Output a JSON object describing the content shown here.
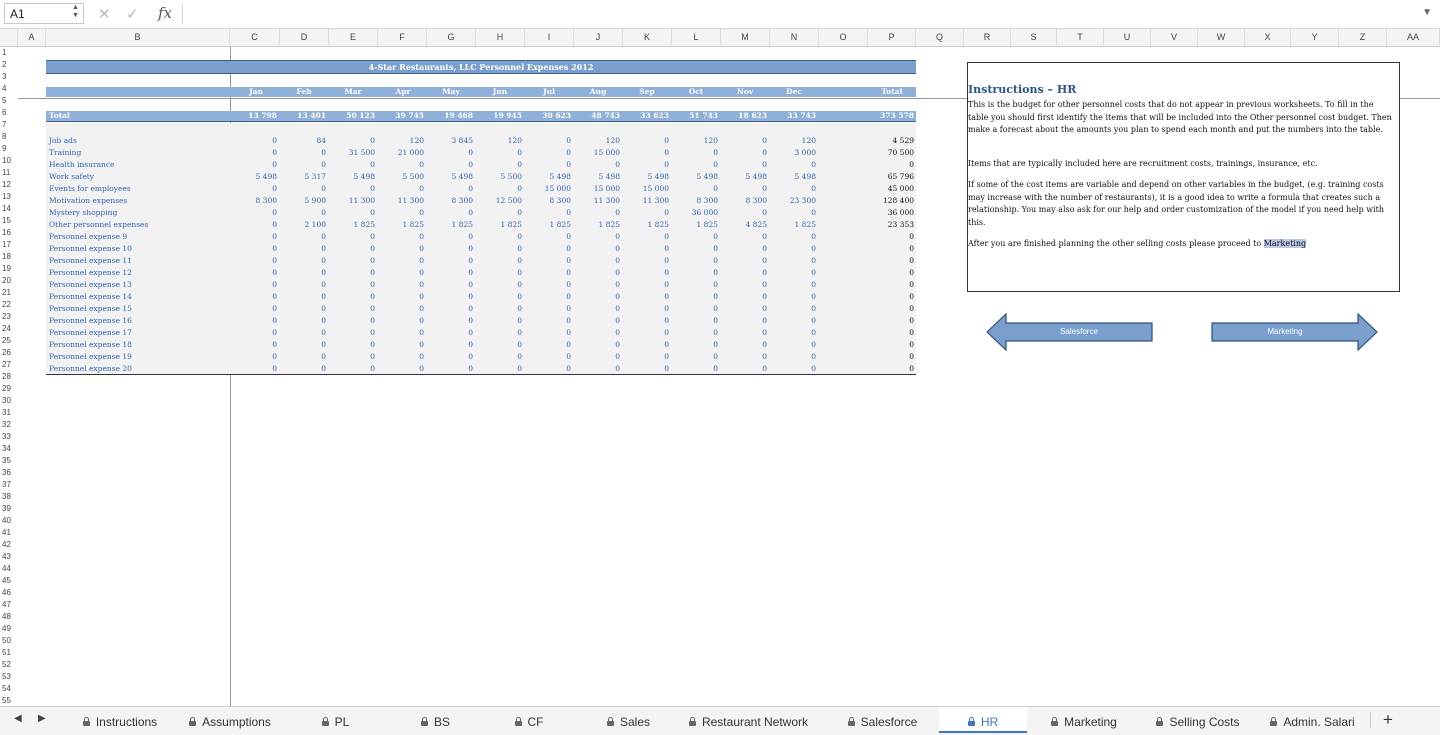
{
  "formula_bar": {
    "cell_ref": "A1",
    "fx_label": "fx",
    "formula": ""
  },
  "columns": [
    "A",
    "B",
    "C",
    "D",
    "E",
    "F",
    "G",
    "H",
    "I",
    "J",
    "K",
    "L",
    "M",
    "N",
    "O",
    "P",
    "Q",
    "R",
    "S",
    "T",
    "U",
    "V",
    "W",
    "X",
    "Y",
    "Z",
    "AA"
  ],
  "rows_start": 1,
  "rows_end": 55,
  "sheet": {
    "title": "4-Star Restaurants, LLC Personnel Expenses 2012",
    "months": [
      "Jan",
      "Feb",
      "Mar",
      "Apr",
      "May",
      "Jun",
      "Jul",
      "Aug",
      "Sep",
      "Oct",
      "Nov",
      "Dec"
    ],
    "total_header": "Total",
    "total_row": {
      "label": "Total",
      "values": [
        "13 798",
        "13 401",
        "50 123",
        "39 745",
        "19 468",
        "19 945",
        "30 623",
        "48 743",
        "33 623",
        "51 743",
        "18 623",
        "33 743"
      ],
      "total": "373 578"
    },
    "items": [
      {
        "label": "Job ads",
        "values": [
          "0",
          "84",
          "0",
          "120",
          "3 845",
          "120",
          "0",
          "120",
          "0",
          "120",
          "0",
          "120"
        ],
        "total": "4 529"
      },
      {
        "label": "Training",
        "values": [
          "0",
          "0",
          "31 500",
          "21 000",
          "0",
          "0",
          "0",
          "15 000",
          "0",
          "0",
          "0",
          "3 000"
        ],
        "total": "70 500"
      },
      {
        "label": "Health insurance",
        "values": [
          "0",
          "0",
          "0",
          "0",
          "0",
          "0",
          "0",
          "0",
          "0",
          "0",
          "0",
          "0"
        ],
        "total": "0"
      },
      {
        "label": "Work safety",
        "values": [
          "5 498",
          "5 317",
          "5 498",
          "5 500",
          "5 498",
          "5 500",
          "5 498",
          "5 498",
          "5 498",
          "5 498",
          "5 498",
          "5 498"
        ],
        "total": "65 796"
      },
      {
        "label": "Events for employees",
        "values": [
          "0",
          "0",
          "0",
          "0",
          "0",
          "0",
          "15 000",
          "15 000",
          "15 000",
          "0",
          "0",
          "0"
        ],
        "total": "45 000"
      },
      {
        "label": "Motivation expenses",
        "values": [
          "8 300",
          "5 900",
          "11 300",
          "11 300",
          "8 300",
          "12 500",
          "8 300",
          "11 300",
          "11 300",
          "8 300",
          "8 300",
          "23 300"
        ],
        "total": "128 400"
      },
      {
        "label": "Mystery shopping",
        "values": [
          "0",
          "0",
          "0",
          "0",
          "0",
          "0",
          "0",
          "0",
          "0",
          "36 000",
          "0",
          "0"
        ],
        "total": "36 000"
      },
      {
        "label": "Other personnel expenses",
        "values": [
          "0",
          "2 100",
          "1 825",
          "1 825",
          "1 825",
          "1 825",
          "1 825",
          "1 825",
          "1 825",
          "1 825",
          "4 825",
          "1 825"
        ],
        "total": "23 353"
      },
      {
        "label": "Personnel expense 9",
        "values": [
          "0",
          "0",
          "0",
          "0",
          "0",
          "0",
          "0",
          "0",
          "0",
          "0",
          "0",
          "0"
        ],
        "total": "0"
      },
      {
        "label": "Personnel expense 10",
        "values": [
          "0",
          "0",
          "0",
          "0",
          "0",
          "0",
          "0",
          "0",
          "0",
          "0",
          "0",
          "0"
        ],
        "total": "0"
      },
      {
        "label": "Personnel expense 11",
        "values": [
          "0",
          "0",
          "0",
          "0",
          "0",
          "0",
          "0",
          "0",
          "0",
          "0",
          "0",
          "0"
        ],
        "total": "0"
      },
      {
        "label": "Personnel expense 12",
        "values": [
          "0",
          "0",
          "0",
          "0",
          "0",
          "0",
          "0",
          "0",
          "0",
          "0",
          "0",
          "0"
        ],
        "total": "0"
      },
      {
        "label": "Personnel expense 13",
        "values": [
          "0",
          "0",
          "0",
          "0",
          "0",
          "0",
          "0",
          "0",
          "0",
          "0",
          "0",
          "0"
        ],
        "total": "0"
      },
      {
        "label": "Personnel expense 14",
        "values": [
          "0",
          "0",
          "0",
          "0",
          "0",
          "0",
          "0",
          "0",
          "0",
          "0",
          "0",
          "0"
        ],
        "total": "0"
      },
      {
        "label": "Personnel expense 15",
        "values": [
          "0",
          "0",
          "0",
          "0",
          "0",
          "0",
          "0",
          "0",
          "0",
          "0",
          "0",
          "0"
        ],
        "total": "0"
      },
      {
        "label": "Personnel expense 16",
        "values": [
          "0",
          "0",
          "0",
          "0",
          "0",
          "0",
          "0",
          "0",
          "0",
          "0",
          "0",
          "0"
        ],
        "total": "0"
      },
      {
        "label": "Personnel expense 17",
        "values": [
          "0",
          "0",
          "0",
          "0",
          "0",
          "0",
          "0",
          "0",
          "0",
          "0",
          "0",
          "0"
        ],
        "total": "0"
      },
      {
        "label": "Personnel expense 18",
        "values": [
          "0",
          "0",
          "0",
          "0",
          "0",
          "0",
          "0",
          "0",
          "0",
          "0",
          "0",
          "0"
        ],
        "total": "0"
      },
      {
        "label": "Personnel expense 19",
        "values": [
          "0",
          "0",
          "0",
          "0",
          "0",
          "0",
          "0",
          "0",
          "0",
          "0",
          "0",
          "0"
        ],
        "total": "0"
      },
      {
        "label": "Personnel expense 20",
        "values": [
          "0",
          "0",
          "0",
          "0",
          "0",
          "0",
          "0",
          "0",
          "0",
          "0",
          "0",
          "0"
        ],
        "total": "0"
      }
    ]
  },
  "instructions": {
    "title": "Instructions – HR",
    "p1": "This is the budget for other personnel costs that do not appear in previous worksheets. To fill in the table you should first identify the items that will be included into the Other personnel cost budget. Then make a forecast about the amounts you plan to spend each month and put the numbers into the table.",
    "p2": "Items that are typically included here are recruitment costs, trainings, insurance, etc.",
    "p3": "If some of the cost items are variable and depend on other variables in the budget, (e.g. training costs may increase with the number of restaurants), it is a good idea to write a formula that creates such a relationship. You may also ask for our help and order customization of the model if you need help with this.",
    "p4_prefix": "After you are finished planning the other selling costs please proceed to ",
    "p4_link": "Marketing"
  },
  "nav_buttons": {
    "back": "Salesforce",
    "next": "Marketing"
  },
  "tabs": [
    {
      "label": "Instructions",
      "locked": true,
      "active": false
    },
    {
      "label": "Assumptions",
      "locked": true,
      "active": false
    },
    {
      "label": "PL",
      "locked": true,
      "active": false
    },
    {
      "label": "BS",
      "locked": true,
      "active": false
    },
    {
      "label": "CF",
      "locked": true,
      "active": false
    },
    {
      "label": "Sales",
      "locked": true,
      "active": false
    },
    {
      "label": "Restaurant Network",
      "locked": true,
      "active": false
    },
    {
      "label": "Salesforce",
      "locked": true,
      "active": false
    },
    {
      "label": "HR",
      "locked": true,
      "active": true
    },
    {
      "label": "Marketing",
      "locked": true,
      "active": false
    },
    {
      "label": "Selling Costs",
      "locked": true,
      "active": false
    },
    {
      "label": "Admin. Salari",
      "locked": true,
      "active": false
    }
  ],
  "add_sheet_label": "+",
  "colors": {
    "accent": "#3f73c6",
    "banner": "#7a9fcd",
    "value_blue": "#2f63b5"
  }
}
